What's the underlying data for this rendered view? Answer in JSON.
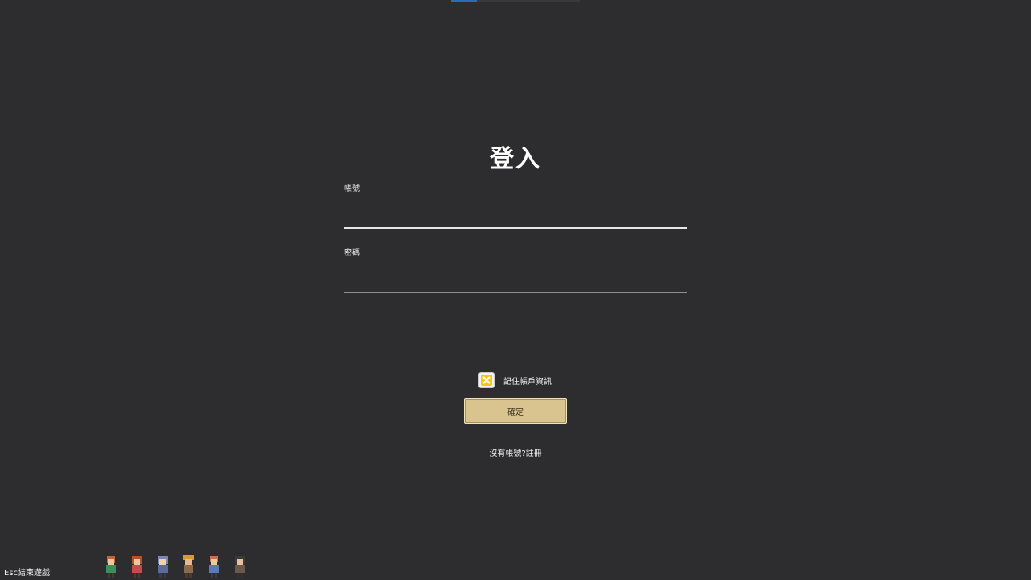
{
  "login": {
    "title": "登入",
    "account_label": "帳號",
    "account_value": "",
    "password_label": "密碼",
    "password_value": "",
    "remember_label": "記住帳戶資訊",
    "remember_checked": true,
    "confirm_label": "確定",
    "register_link": "沒有帳號?註冊"
  },
  "footer": {
    "esc_hint": "Esc結束遊戲",
    "characters": [
      {
        "icon": "character-sprite-icon",
        "hair": "#c8643c",
        "shirt": "#3a8f5a"
      },
      {
        "icon": "character-sprite-icon",
        "hair": "#b8502c",
        "shirt": "#c84a4a"
      },
      {
        "icon": "character-sprite-icon",
        "hair": "#7a86b8",
        "shirt": "#5a6a9a"
      },
      {
        "icon": "character-sprite-icon",
        "hair": "#d89a30",
        "shirt": "#8a6a4a"
      },
      {
        "icon": "character-sprite-icon",
        "hair": "#c87050",
        "shirt": "#5a7ab8"
      },
      {
        "icon": "character-sprite-icon",
        "hair": "#3a3a3a",
        "shirt": "#6a5a4a"
      }
    ]
  },
  "colors": {
    "background": "#2d2d2f",
    "accent": "#f5c518",
    "button": "#d9c48f",
    "tab_active": "#2b6cb8"
  }
}
